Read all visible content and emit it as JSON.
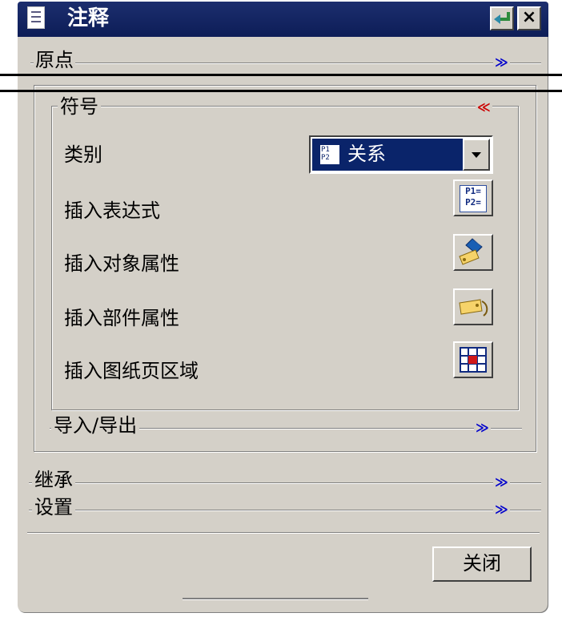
{
  "window": {
    "title": "注释"
  },
  "sections": {
    "origin": "原点",
    "symbol": "符号",
    "import_export": "导入/导出",
    "inherit": "继承",
    "settings": "设置"
  },
  "symbol": {
    "category_label": "类别",
    "category_value": "关系",
    "rows": [
      {
        "label": "插入表达式",
        "icon": "expression-icon"
      },
      {
        "label": "插入对象属性",
        "icon": "object-attribute-tag-icon"
      },
      {
        "label": "插入部件属性",
        "icon": "part-attribute-tag-icon"
      },
      {
        "label": "插入图纸页区域",
        "icon": "drawing-sheet-zone-icon"
      }
    ]
  },
  "icons": {
    "expression_text_1": "P1=",
    "expression_text_2": "P2="
  },
  "close_button": "关闭",
  "colors": {
    "title_bar": "#0d1d57",
    "panel": "#d4d0c8",
    "chevron_blue": "#0000cc",
    "chevron_red": "#cc0000"
  }
}
